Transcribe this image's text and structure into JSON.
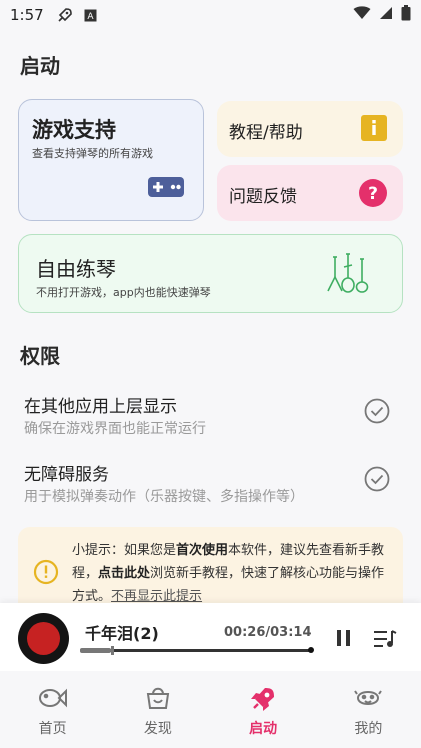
{
  "status_bar": {
    "time": "1:57"
  },
  "sections": {
    "start": "启动",
    "permissions": "权限"
  },
  "cards": {
    "game_support": {
      "title": "游戏支持",
      "subtitle": "查看支持弹琴的所有游戏"
    },
    "help": {
      "title": "教程/帮助"
    },
    "feedback": {
      "title": "问题反馈"
    },
    "free_practice": {
      "title": "自由练琴",
      "subtitle": "不用打开游戏，app内也能快速弹琴"
    }
  },
  "permissions": [
    {
      "title": "在其他应用上层显示",
      "subtitle": "确保在游戏界面也能正常运行"
    },
    {
      "title": "无障碍服务",
      "subtitle": "用于模拟弹奏动作（乐器按键、多指操作等）"
    }
  ],
  "tip": {
    "p1": "小提示：如果您是",
    "b1": "首次使用",
    "p2": "本软件，建议先查看新手教程，",
    "b2": "点击此处",
    "p3": "浏览新手教程，快速了解核心功能与操作方式。",
    "link": "不再显示此提示"
  },
  "player": {
    "song": "千年泪(2)",
    "time": "00:26/03:14",
    "progress": 0.134
  },
  "tabs": [
    {
      "label": "首页",
      "icon": "fish-icon"
    },
    {
      "label": "发现",
      "icon": "basket-icon"
    },
    {
      "label": "启动",
      "icon": "rocket-icon"
    },
    {
      "label": "我的",
      "icon": "face-icon"
    }
  ],
  "active_tab": "启动",
  "colors": {
    "accent": "#e4306b",
    "help_badge": "#e6b422",
    "feedback_badge": "#e4306b",
    "check": "#777777"
  }
}
